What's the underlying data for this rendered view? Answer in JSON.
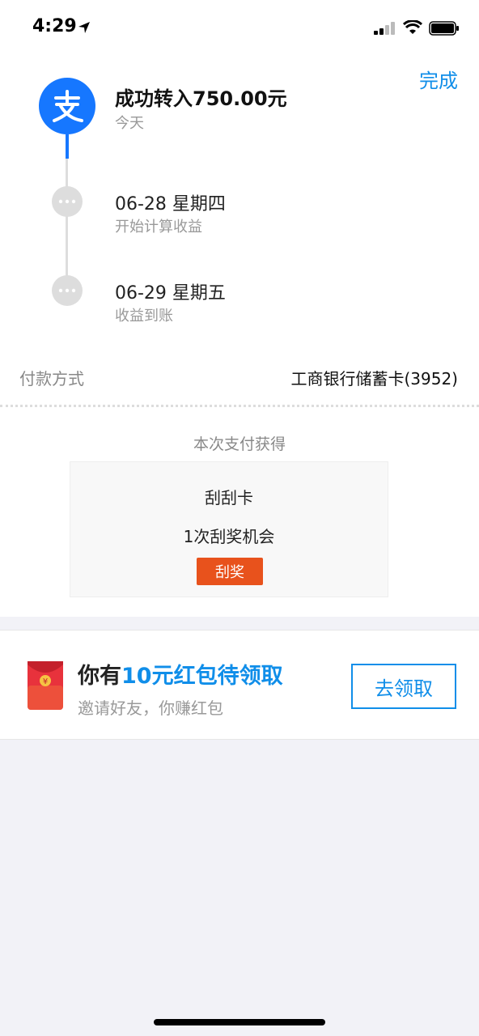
{
  "status_bar": {
    "time": "4:29"
  },
  "header": {
    "done_label": "完成"
  },
  "timeline": {
    "main": {
      "title": "成功转入750.00元",
      "sub": "今天"
    },
    "step1": {
      "title": "06-28 星期四",
      "sub": "开始计算收益"
    },
    "step2": {
      "title": "06-29 星期五",
      "sub": "收益到账"
    }
  },
  "payment": {
    "label": "付款方式",
    "value": "工商银行储蓄卡(3952)"
  },
  "reward": {
    "title": "本次支付获得",
    "card_name": "刮刮卡",
    "card_desc": "1次刮奖机会",
    "button_label": "刮奖"
  },
  "promo": {
    "title_prefix": "你有",
    "title_accent": "10元红包待领取",
    "subtitle": "邀请好友，你赚红包",
    "button_label": "去领取",
    "yen_symbol": "¥"
  },
  "colors": {
    "accent": "#108ee9",
    "alipay_blue": "#1677ff",
    "scratch_orange": "#e8521c"
  }
}
